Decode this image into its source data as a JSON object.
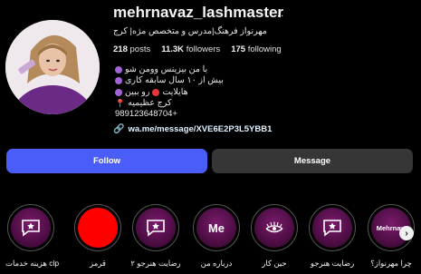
{
  "profile": {
    "username": "mehrnavaz_lashmaster",
    "more_icon": "...",
    "full_name": "مهرنواز فرهنگ|مدرس و متخصص مژه| کرج",
    "stats": {
      "posts_value": "218",
      "posts_label": "posts",
      "followers_value": "11.3K",
      "followers_label": "followers",
      "following_value": "175",
      "following_label": "following"
    },
    "bio": {
      "line1": "با من بیزینس وومن شو",
      "line2": "بیش از ۱۰ سال سابقه کاری",
      "line3": "هایلایت",
      "line3b": "رو ببین",
      "line4": "کرج عظیمیه",
      "line5": "989123648704+"
    },
    "link": "wa.me/message/XVE6E2P3L5YBB1"
  },
  "actions": {
    "follow_label": "Follow",
    "message_label": "Message"
  },
  "highlights": [
    {
      "label": "هزینه خدمات clp"
    },
    {
      "label": "قرمز"
    },
    {
      "label": "رضایت هنرجو ۲"
    },
    {
      "label": "درباره من",
      "inner": "Me"
    },
    {
      "label": "حین کار"
    },
    {
      "label": "رضایت هنرجو"
    },
    {
      "label": "چرا مهرنواز؟",
      "inner": "Mehrnaw"
    }
  ],
  "colors": {
    "follow": "#4a5df9",
    "message": "#363636",
    "highlight_bg": "#5a0f4f",
    "red_highlight": "#ff0000"
  },
  "icons": {
    "more": "more-horizontal-icon",
    "link": "link-icon",
    "next": "chevron-right-icon",
    "star_chat": "star-chat-icon",
    "lash": "eyelash-icon"
  }
}
